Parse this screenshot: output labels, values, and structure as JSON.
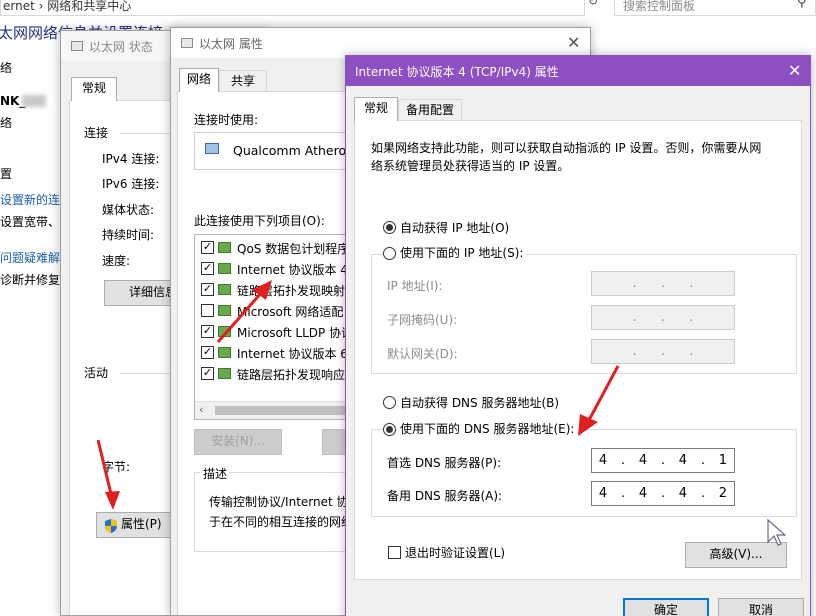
{
  "bg": {
    "breadcrumb": "ernet  ›  网络和共享中心",
    "search_placeholder": "搜索控制面板",
    "title": "太网网络信息并设置连接",
    "left_items": [
      "络",
      "NK_",
      "络",
      "置",
      "设置新的连",
      "设置宽带、",
      "问题疑难解",
      "诊断并修复"
    ]
  },
  "status_window": {
    "title": "以太网 状态",
    "tab": "常规",
    "connection_heading": "连接",
    "fields": [
      "IPv4 连接:",
      "IPv6 连接:",
      "媒体状态:",
      "持续时间:",
      "速度:"
    ],
    "details_button": "详细信息",
    "activity_heading": "活动",
    "bytes_label": "字节:",
    "properties_button": "属性(P)"
  },
  "props_window": {
    "title": "以太网 属性",
    "tabs": [
      "网络",
      "共享"
    ],
    "connect_using_label": "连接时使用:",
    "adapter_name": "Qualcomm Atheros",
    "items_label": "此连接使用下列项目(O):",
    "items": [
      {
        "label": "QoS 数据包计划程序",
        "checked": true
      },
      {
        "label": "Internet 协议版本 4",
        "checked": true
      },
      {
        "label": "链路层拓扑发现映射",
        "checked": true
      },
      {
        "label": "Microsoft 网络适配",
        "checked": false
      },
      {
        "label": "Microsoft LLDP 协议",
        "checked": true
      },
      {
        "label": "Internet 协议版本 6",
        "checked": true
      },
      {
        "label": "链路层拓扑发现响应",
        "checked": true
      }
    ],
    "install_button": "安装(N)...",
    "description_label": "描述",
    "description_text_1": "传输控制协议/Internet 协",
    "description_text_2": "于在不同的相互连接的网络"
  },
  "ipv4_window": {
    "title": "Internet 协议版本 4 (TCP/IPv4) 属性",
    "accent_color": "#8e4fc3",
    "tabs": [
      "常规",
      "备用配置"
    ],
    "description_1": "如果网络支持此功能，则可以获取自动指派的 IP 设置。否则，你需要从网",
    "description_2": "络系统管理员处获得适当的 IP 设置。",
    "auto_ip_radio": "自动获得 IP 地址(O)",
    "manual_ip_radio": "使用下面的 IP 地址(S):",
    "ip_label": "IP 地址(I):",
    "mask_label": "子网掩码(U):",
    "gateway_label": "默认网关(D):",
    "auto_dns_radio": "自动获得 DNS 服务器地址(B)",
    "manual_dns_radio": "使用下面的 DNS 服务器地址(E):",
    "preferred_dns_label": "首选 DNS 服务器(P):",
    "preferred_dns_octets": [
      "4",
      "4",
      "4",
      "1"
    ],
    "alternate_dns_label": "备用 DNS 服务器(A):",
    "alternate_dns_octets": [
      "4",
      "4",
      "4",
      "2"
    ],
    "validate_checkbox": "退出时验证设置(L)",
    "advanced_button": "高级(V)...",
    "ok_button": "确定",
    "cancel_button": "取消"
  },
  "annotation_color": "#e02020"
}
